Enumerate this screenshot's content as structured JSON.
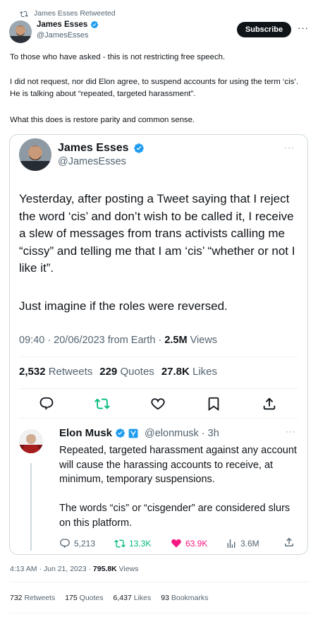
{
  "retweet_banner": {
    "icon": "retweet-icon",
    "label": "James Esses Retweeted"
  },
  "author": {
    "name": "James Esses",
    "handle": "@JamesEsses",
    "verified": true
  },
  "subscribe_label": "Subscribe",
  "more_label": "···",
  "tweet": {
    "paragraphs": [
      "To those who have asked - this is not restricting free speech.",
      "I did not request, nor did Elon agree, to suspend accounts for using the term ‘cis’. He is talking about “repeated, targeted harassment”.",
      "What this does is restore parity and common sense."
    ],
    "time": "4:13 AM · Jun 21, 2023 · ",
    "views": "795.8K",
    "views_label": " Views",
    "stats": [
      {
        "value": "732",
        "label": " Retweets"
      },
      {
        "value": "175",
        "label": " Quotes"
      },
      {
        "value": "6,437",
        "label": " Likes"
      },
      {
        "value": "93",
        "label": " Bookmarks"
      }
    ]
  },
  "quoted": {
    "name": "James Esses",
    "handle": "@JamesEsses",
    "more": "···",
    "paragraphs": [
      "Yesterday, after posting a Tweet saying that I reject the word ‘cis’ and don’t wish to be called it, I receive a slew of messages from trans activists calling me “cissy” and telling me that I am ‘cis’ “whether or not I like it”.",
      "Just imagine if the roles were reversed."
    ],
    "meta_time": "09:40 · 20/06/2023 from Earth · ",
    "meta_views": "2.5M",
    "meta_views_label": " Views",
    "stats": [
      {
        "value": "2,532",
        "label": " Retweets"
      },
      {
        "value": "229",
        "label": " Quotes"
      },
      {
        "value": "27.8K",
        "label": " Likes"
      }
    ]
  },
  "reply": {
    "name": "Elon Musk",
    "handle": "@elonmusk · 3h",
    "more": "···",
    "paragraphs": [
      "Repeated, targeted harassment against any account will cause the harassing accounts to receive, at minimum, temporary suspensions.",
      "The words “cis” or “cisgender” are considered slurs on this platform."
    ],
    "stats": {
      "replies": "5,213",
      "retweets": "13.3K",
      "likes": "63.9K",
      "views": "3.6M"
    }
  },
  "colors": {
    "verified_blue": "#1d9bf0",
    "retweet_green": "#00ba7c",
    "like_pink": "#f91880",
    "muted_gray": "#536471",
    "border": "#cfd9de"
  }
}
